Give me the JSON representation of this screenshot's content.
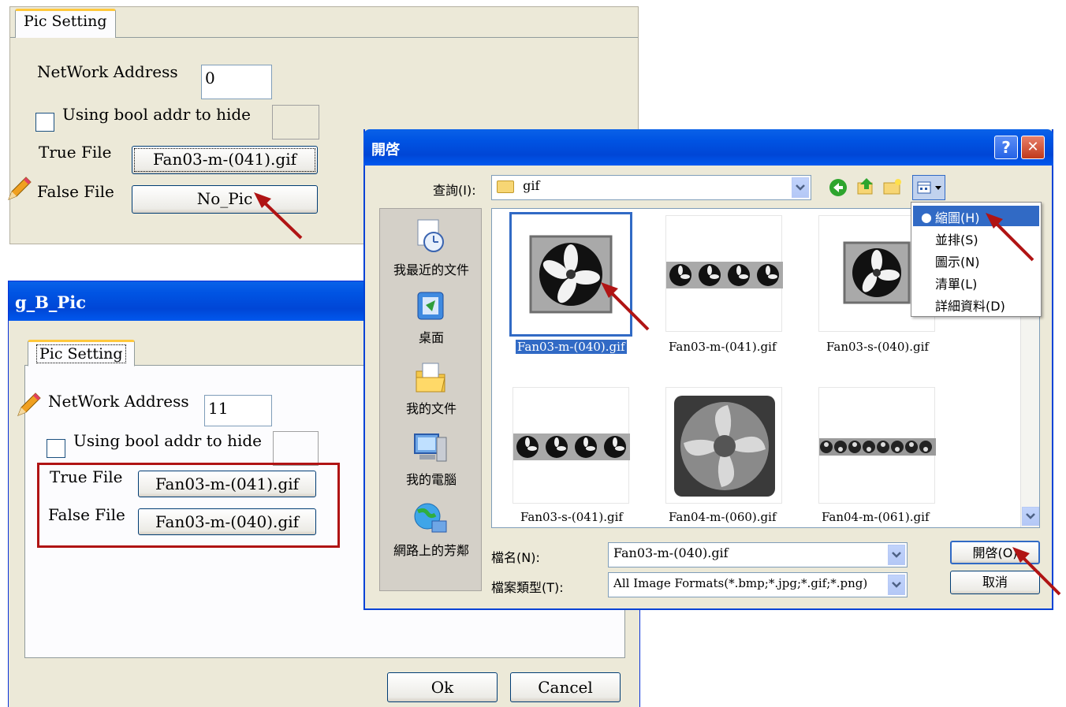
{
  "top_panel": {
    "tab": "Pic Setting",
    "network_label": "NetWork Address",
    "network_value": "0",
    "hide_label": "Using bool addr to hide",
    "true_label": "True File",
    "true_button": "Fan03-m-(041).gif",
    "false_label": "False File",
    "false_button": "No_Pic"
  },
  "bottom_window": {
    "title": "g_B_Pic",
    "tab": "Pic Setting",
    "network_label": "NetWork Address",
    "network_value": "11",
    "hide_label": "Using bool addr to hide",
    "true_label": "True File",
    "true_button": "Fan03-m-(041).gif",
    "false_label": "False File",
    "false_button": "Fan03-m-(040).gif",
    "ok": "Ok",
    "cancel": "Cancel"
  },
  "dialog": {
    "title": "開啓",
    "help": "?",
    "close": "✕",
    "lookin_label": "查詢(I):",
    "lookin_value": "gif",
    "places": [
      "我最近的文件",
      "桌面",
      "我的文件",
      "我的電腦",
      "網路上的芳鄰"
    ],
    "files": [
      "Fan03-m-(040).gif",
      "Fan03-m-(041).gif",
      "Fan03-s-(040).gif",
      "Fan03-s-(041).gif",
      "Fan04-m-(060).gif",
      "Fan04-m-(061).gif"
    ],
    "view_menu": [
      "縮圖(H)",
      "並排(S)",
      "圖示(N)",
      "清單(L)",
      "詳細資料(D)"
    ],
    "filename_label": "檔名(N):",
    "filename_value": "Fan03-m-(040).gif",
    "filetype_label": "檔案類型(T):",
    "filetype_value": "All Image Formats(*.bmp;*.jpg;*.gif;*.png)",
    "open_button": "開啓(O)",
    "cancel_button": "取消"
  },
  "colors": {
    "xp_blue": "#0054e3",
    "highlight_frame": "#b01414",
    "arrow": "#b01414"
  }
}
